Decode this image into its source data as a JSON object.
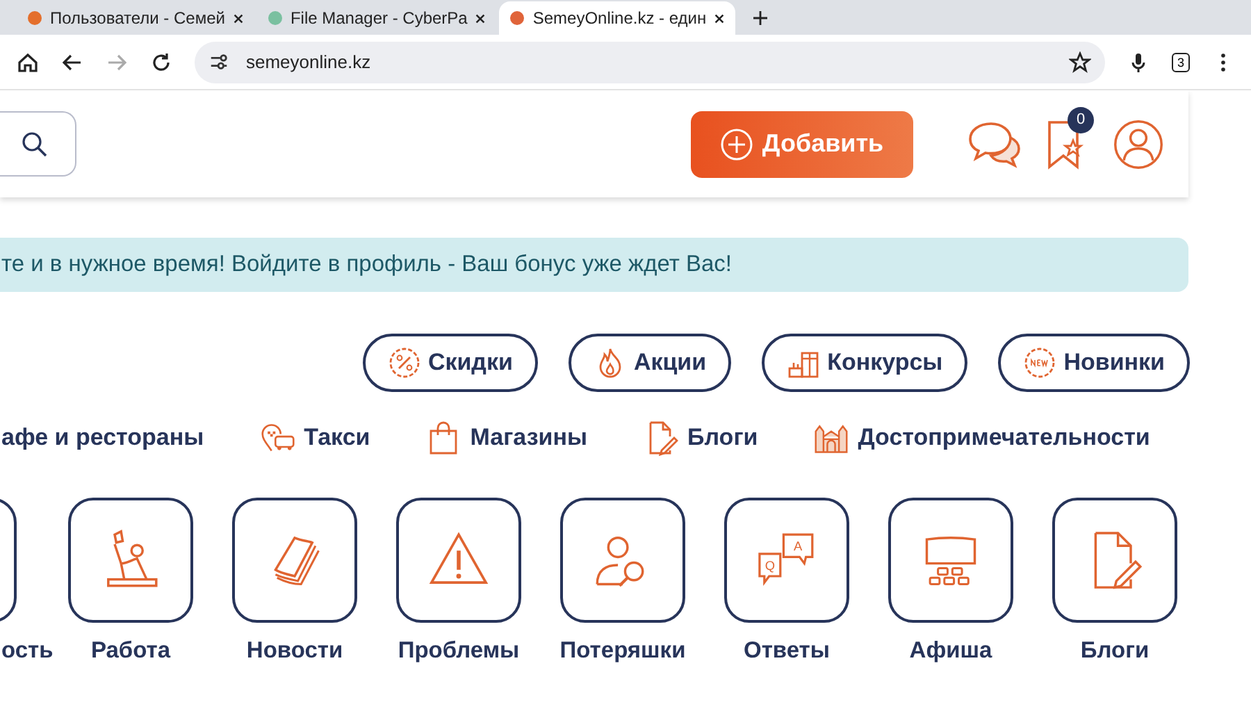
{
  "browser": {
    "tabs": [
      {
        "title": "Пользователи - Семей",
        "selected": false
      },
      {
        "title": "File Manager - CyberPa",
        "selected": false
      },
      {
        "title": "SemeyOnline.kz - един",
        "selected": true
      }
    ],
    "address": "semeyonline.kz",
    "tab_count": "3"
  },
  "header": {
    "add_button": "Добавить",
    "bookmarks_badge": "0"
  },
  "banner": "те и в нужное время! Войдите в профиль - Ваш бонус уже ждет Вас!",
  "pills": [
    {
      "label": "Скидки",
      "kind": "percent"
    },
    {
      "label": "Акции",
      "kind": "flame"
    },
    {
      "label": "Конкурсы",
      "kind": "gift"
    },
    {
      "label": "Новинки",
      "kind": "new"
    }
  ],
  "categories": [
    {
      "label": "афе и рестораны",
      "kind": "none"
    },
    {
      "label": "Такси",
      "kind": "taxi"
    },
    {
      "label": "Магазины",
      "kind": "bag"
    },
    {
      "label": "Блоги",
      "kind": "doc"
    },
    {
      "label": "Достопримечательности",
      "kind": "landmark"
    }
  ],
  "tiles": [
    {
      "label": "ость",
      "kind": "none"
    },
    {
      "label": "Работа",
      "kind": "work"
    },
    {
      "label": "Новости",
      "kind": "news"
    },
    {
      "label": "Проблемы",
      "kind": "warning"
    },
    {
      "label": "Потеряшки",
      "kind": "lost"
    },
    {
      "label": "Ответы",
      "kind": "qa",
      "icon_letters": [
        "Q",
        "A"
      ]
    },
    {
      "label": "Афиша",
      "kind": "cinema"
    },
    {
      "label": "Блоги",
      "kind": "doc"
    }
  ]
}
